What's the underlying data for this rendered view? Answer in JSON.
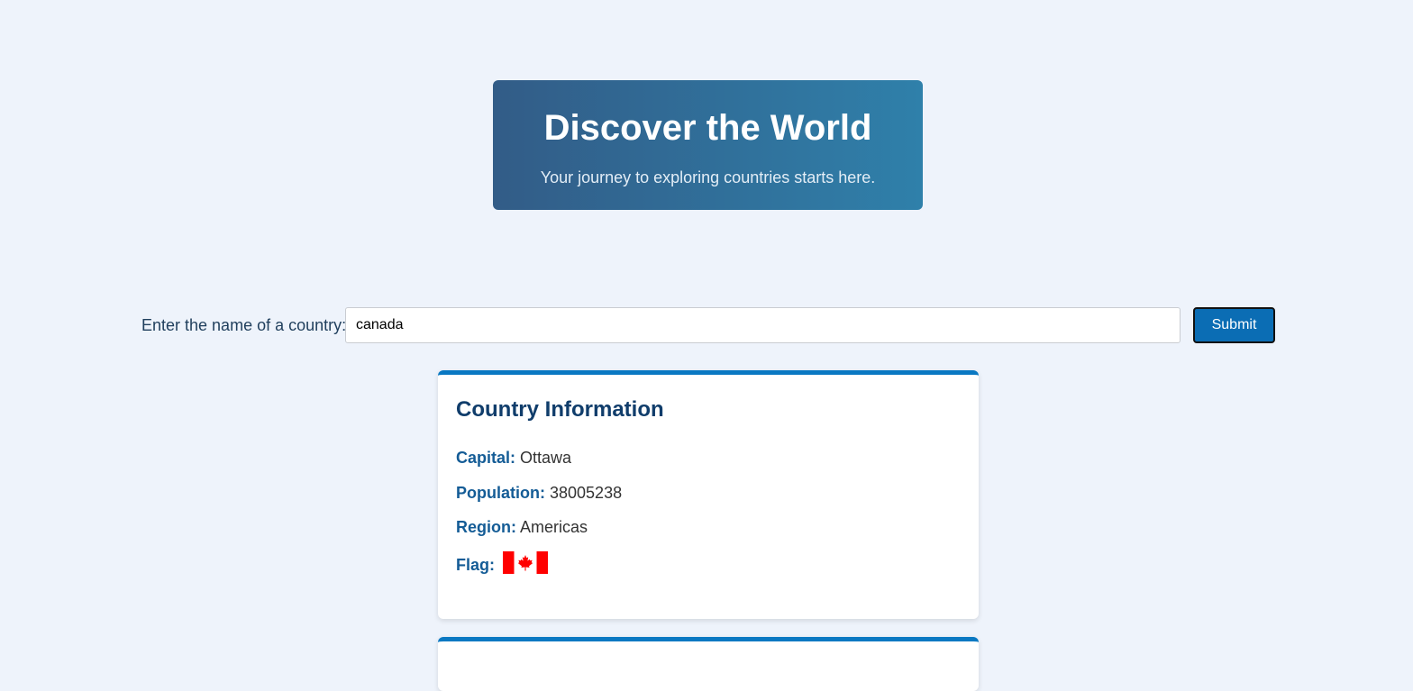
{
  "hero": {
    "title": "Discover the World",
    "subtitle": "Your journey to exploring countries starts here."
  },
  "search": {
    "label": "Enter the name of a country:",
    "value": "canada",
    "submit_label": "Submit"
  },
  "country_info": {
    "heading": "Country Information",
    "fields": [
      {
        "key": "Capital:",
        "value": "Ottawa"
      },
      {
        "key": "Population:",
        "value": "38005238"
      },
      {
        "key": "Region:",
        "value": "Americas"
      },
      {
        "key": "Flag:",
        "value": ""
      }
    ],
    "flag_icon": "canada-flag-icon"
  },
  "colors": {
    "accent": "#0a78c2",
    "button": "#0b6db4",
    "background": "#eef3fb"
  }
}
